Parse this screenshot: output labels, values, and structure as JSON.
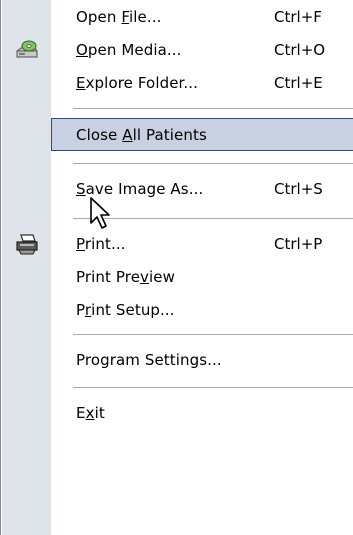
{
  "menu": {
    "items": [
      {
        "pre": "Open ",
        "ul": "F",
        "post": "ile...",
        "shortcut": "Ctrl+F"
      },
      {
        "pre": "",
        "ul": "O",
        "post": "pen Media...",
        "shortcut": "Ctrl+O",
        "icon": "open-media-icon"
      },
      {
        "pre": "",
        "ul": "E",
        "post": "xplore Folder...",
        "shortcut": "Ctrl+E"
      },
      {
        "pre": "Close ",
        "ul": "A",
        "post": "ll Patients",
        "shortcut": "",
        "highlighted": true
      },
      {
        "pre": "",
        "ul": "S",
        "post": "ave Image As...",
        "shortcut": "Ctrl+S"
      },
      {
        "pre": "",
        "ul": "P",
        "post": "rint...",
        "shortcut": "Ctrl+P",
        "icon": "printer-icon"
      },
      {
        "pre": "Print Pre",
        "ul": "v",
        "post": "iew",
        "shortcut": ""
      },
      {
        "pre": "P",
        "ul": "r",
        "post": "int Setup...",
        "shortcut": ""
      },
      {
        "pre": "Program Settings...",
        "ul": "",
        "post": "",
        "shortcut": ""
      },
      {
        "pre": "E",
        "ul": "x",
        "post": "it",
        "shortcut": ""
      }
    ]
  },
  "colors": {
    "gutter": "#dfe4eb",
    "highlight_fill": "#c7d1e2",
    "highlight_border": "#2b4b8c",
    "separator": "#a7abb0"
  }
}
